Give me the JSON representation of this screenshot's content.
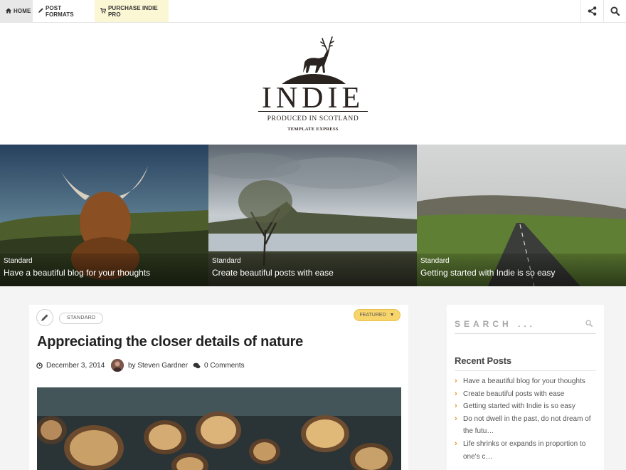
{
  "nav": {
    "home": "HOME",
    "post_formats": "POST FORMATS",
    "purchase": "PURCHASE INDIE PRO",
    "share_icon": "share-icon",
    "search_icon": "search-icon"
  },
  "logo": {
    "title": "INDIE",
    "tagline": "PRODUCED IN SCOTLAND",
    "sub": "TEMPLATE EXPRESS"
  },
  "slides": [
    {
      "category": "Standard",
      "title": "Have a beautiful blog for your thoughts"
    },
    {
      "category": "Standard",
      "title": "Create beautiful posts with ease"
    },
    {
      "category": "Standard",
      "title": "Getting started with Indie is so easy"
    }
  ],
  "post": {
    "format_icon": "pencil-icon",
    "category": "STANDARD",
    "featured": "FEATURED",
    "title": "Appreciating the closer details of nature",
    "date": "December 3, 2014",
    "author": "by Steven Gardner",
    "comments": "0 Comments"
  },
  "sidebar": {
    "search_placeholder": "SEARCH ...",
    "recent_title": "Recent Posts",
    "recent_posts": [
      "Have a beautiful blog for your thoughts",
      "Create beautiful posts with ease",
      "Getting started with Indie is so easy",
      "Do not dwell in the past, do not dream of the futu…",
      "Life shrinks or expands in proportion to one's c…"
    ]
  },
  "colors": {
    "accent": "#e09a22",
    "featured_bg": "#f7d56b",
    "purchase_bg": "#fbf6d4"
  }
}
